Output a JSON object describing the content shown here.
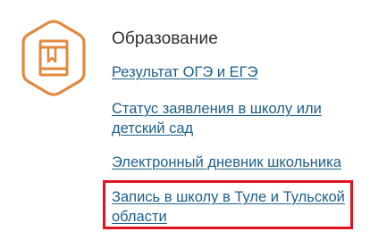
{
  "section": {
    "icon": "book-icon",
    "title": "Образование",
    "accent_color": "#e2893c",
    "links": [
      "Результат ОГЭ и ЕГЭ",
      "Статус заявления в школу или детский сад",
      "Электронный дневник школьника",
      "Запись в школу в Туле и Тульской области"
    ]
  },
  "highlight_color": "#e0141e",
  "link_color": "#1d5f8a"
}
